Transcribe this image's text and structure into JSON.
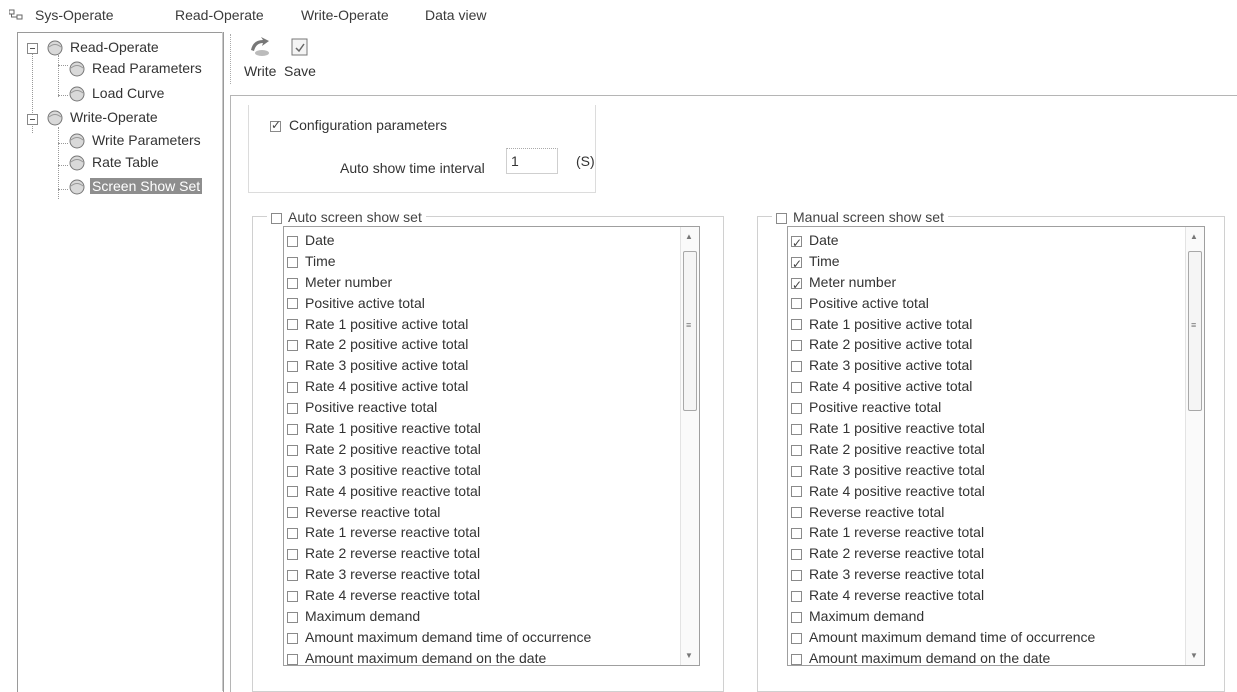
{
  "menu": {
    "items": [
      "Sys-Operate",
      "Read-Operate",
      "Write-Operate",
      "Data view"
    ]
  },
  "tree": {
    "nodes": [
      {
        "label": "Read-Operate",
        "level": 0,
        "expanded": true
      },
      {
        "label": "Read Parameters",
        "level": 1
      },
      {
        "label": "Load Curve",
        "level": 1
      },
      {
        "label": "Write-Operate",
        "level": 0,
        "expanded": true
      },
      {
        "label": "Write Parameters",
        "level": 1
      },
      {
        "label": "Rate Table",
        "level": 1
      },
      {
        "label": "Screen Show Set",
        "level": 1,
        "selected": true
      }
    ]
  },
  "toolbar": {
    "write_label": "Write",
    "save_label": "Save",
    "write_icon": "write-icon",
    "save_icon": "save-icon"
  },
  "config": {
    "label": "Configuration parameters",
    "checked": true,
    "interval_label": "Auto show time interval",
    "interval_value": "1",
    "interval_unit": "(S)"
  },
  "auto_group": {
    "title": "Auto screen show set",
    "checked": false,
    "items": [
      {
        "label": "Date",
        "checked": false
      },
      {
        "label": "Time",
        "checked": false
      },
      {
        "label": "Meter number",
        "checked": false
      },
      {
        "label": "Positive active total",
        "checked": false
      },
      {
        "label": "Rate 1 positive active total",
        "checked": false
      },
      {
        "label": "Rate 2 positive active total",
        "checked": false
      },
      {
        "label": "Rate 3 positive active total",
        "checked": false
      },
      {
        "label": "Rate 4 positive active total",
        "checked": false
      },
      {
        "label": "Positive reactive total",
        "checked": false
      },
      {
        "label": "Rate 1 positive reactive total",
        "checked": false
      },
      {
        "label": "Rate 2 positive reactive total",
        "checked": false
      },
      {
        "label": "Rate 3 positive reactive total",
        "checked": false
      },
      {
        "label": "Rate 4 positive reactive total",
        "checked": false
      },
      {
        "label": "Reverse reactive total",
        "checked": false
      },
      {
        "label": "Rate 1 reverse reactive total",
        "checked": false
      },
      {
        "label": "Rate 2 reverse reactive total",
        "checked": false
      },
      {
        "label": "Rate 3 reverse reactive total",
        "checked": false
      },
      {
        "label": "Rate 4 reverse reactive total",
        "checked": false
      },
      {
        "label": "Maximum demand",
        "checked": false
      },
      {
        "label": "Amount maximum demand time of occurrence",
        "checked": false
      },
      {
        "label": "Amount maximum demand on the date",
        "checked": false
      }
    ]
  },
  "manual_group": {
    "title": "Manual screen show set",
    "checked": false,
    "items": [
      {
        "label": "Date",
        "checked": true
      },
      {
        "label": "Time",
        "checked": true
      },
      {
        "label": "Meter number",
        "checked": true
      },
      {
        "label": "Positive active total",
        "checked": false
      },
      {
        "label": "Rate 1 positive active total",
        "checked": false
      },
      {
        "label": "Rate 2 positive active total",
        "checked": false
      },
      {
        "label": "Rate 3 positive active total",
        "checked": false
      },
      {
        "label": "Rate 4 positive active total",
        "checked": false
      },
      {
        "label": "Positive reactive total",
        "checked": false
      },
      {
        "label": "Rate 1 positive reactive total",
        "checked": false
      },
      {
        "label": "Rate 2 positive reactive total",
        "checked": false
      },
      {
        "label": "Rate 3 positive reactive total",
        "checked": false
      },
      {
        "label": "Rate 4 positive reactive total",
        "checked": false
      },
      {
        "label": "Reverse reactive total",
        "checked": false
      },
      {
        "label": "Rate 1 reverse reactive total",
        "checked": false
      },
      {
        "label": "Rate 2 reverse reactive total",
        "checked": false
      },
      {
        "label": "Rate 3 reverse reactive total",
        "checked": false
      },
      {
        "label": "Rate 4 reverse reactive total",
        "checked": false
      },
      {
        "label": "Maximum demand",
        "checked": false
      },
      {
        "label": "Amount maximum demand time of occurrence",
        "checked": false
      },
      {
        "label": "Amount maximum demand on the date",
        "checked": false
      }
    ]
  }
}
